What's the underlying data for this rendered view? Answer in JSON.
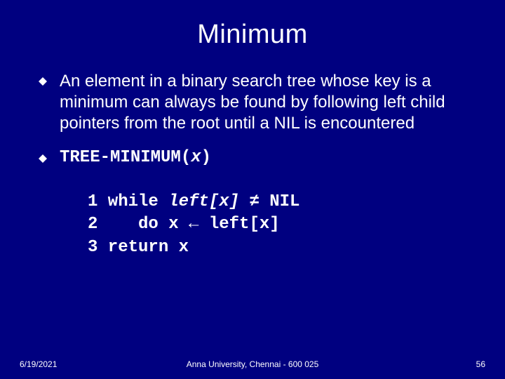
{
  "title": "Minimum",
  "bullets": [
    {
      "text": "An element in a binary search tree whose key is a minimum can always be found by following left child pointers from the root until a NIL is encountered"
    }
  ],
  "proc": {
    "name": "TREE-MINIMUM",
    "arg": "x"
  },
  "code": {
    "l1_a": "1 while ",
    "l1_b": "left[x]",
    "l1_c": " ≠ NIL",
    "l2": "2    do x ← left[x]",
    "l3": "3 return x"
  },
  "footer": {
    "date": "6/19/2021",
    "org": "Anna University, Chennai - 600 025",
    "num": "56"
  }
}
